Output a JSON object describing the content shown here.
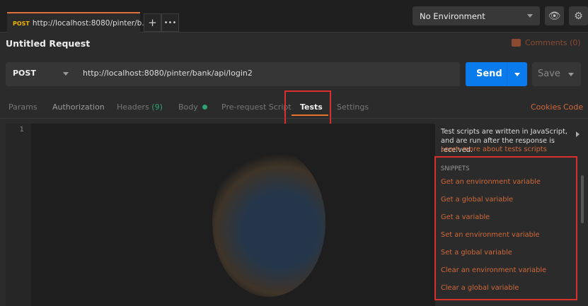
{
  "tab": {
    "method": "POST",
    "url": "http://localhost:8080/pinter/b..."
  },
  "toolbar": {
    "new_tab": "+",
    "more": "•••"
  },
  "environment": {
    "selected": "No Environment"
  },
  "request": {
    "title": "Untitled Request",
    "comments": "Comments (0)",
    "method": "POST",
    "url": "http://localhost:8080/pinter/bank/api/login2",
    "send": "Send",
    "save": "Save"
  },
  "tabs": [
    {
      "label": "Params"
    },
    {
      "label": "Authorization"
    },
    {
      "label": "Headers",
      "count": "(9)"
    },
    {
      "label": "Body"
    },
    {
      "label": "Pre-request Script"
    },
    {
      "label": "Tests"
    },
    {
      "label": "Settings"
    }
  ],
  "links": {
    "cookies": "Cookies",
    "code": "Code"
  },
  "editor": {
    "line": "1"
  },
  "side": {
    "description": "Test scripts are written in JavaScript, and are run after the response is received.",
    "learn_more": "Learn more about tests scripts",
    "snippets_header": "SNIPPETS",
    "snippets": [
      "Get an environment variable",
      "Get a global variable",
      "Get a variable",
      "Set an environment variable",
      "Set a global variable",
      "Clear an environment variable",
      "Clear a global variable"
    ]
  }
}
